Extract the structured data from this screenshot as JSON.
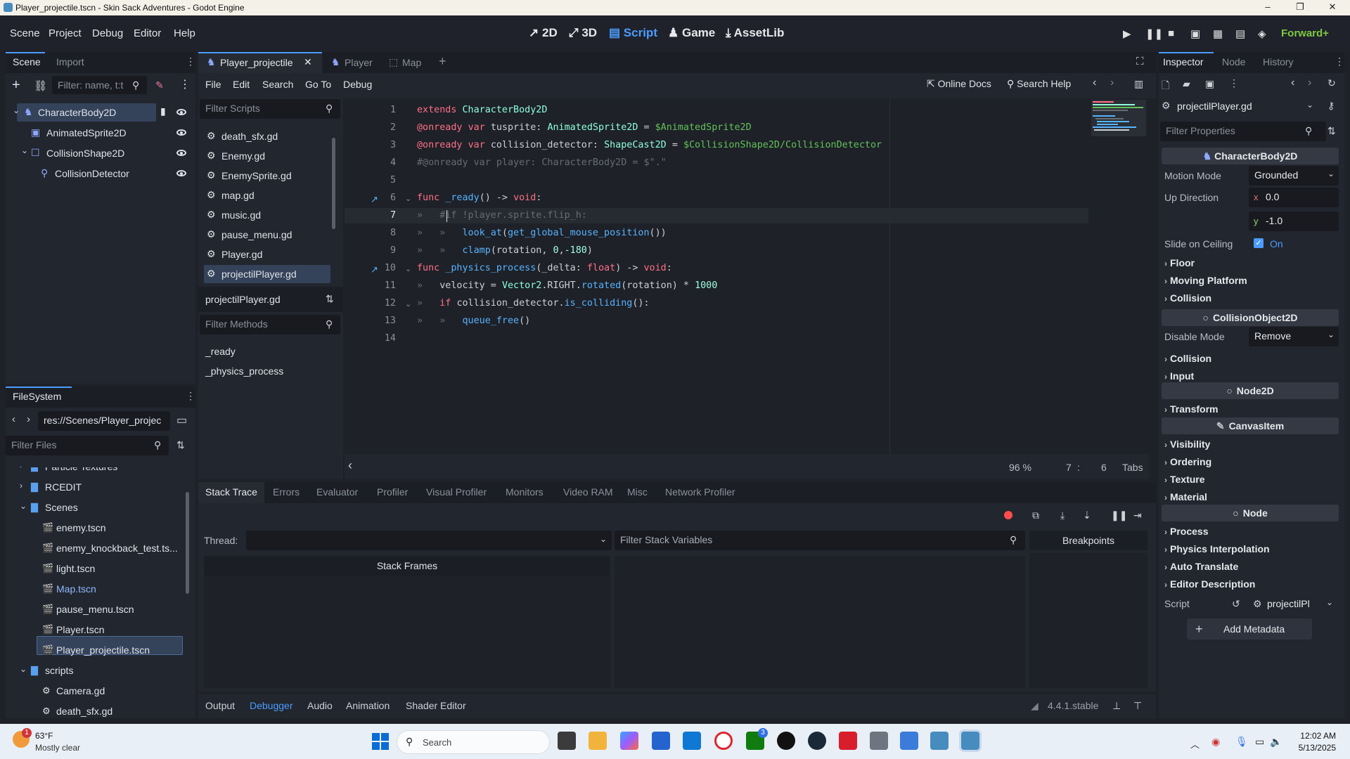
{
  "window": {
    "title": "Player_projectile.tscn - Skin Sack Adventures - Godot Engine",
    "minimize": "–",
    "maximize": "❐",
    "close": "✕"
  },
  "menu": [
    "Scene",
    "Project",
    "Debug",
    "Editor",
    "Help"
  ],
  "workspaces": [
    {
      "icon": "↗",
      "label": "2D"
    },
    {
      "icon": "⤢",
      "label": "3D"
    },
    {
      "icon": "▤",
      "label": "Script"
    },
    {
      "icon": "♟",
      "label": "Game"
    },
    {
      "icon": "⤓",
      "label": "AssetLib"
    }
  ],
  "renderer": "Forward+",
  "scene_dock": {
    "tabs": [
      "Scene",
      "Import"
    ],
    "filter_placeholder": "Filter: name, t:t",
    "nodes": [
      {
        "name": "CharacterBody2D",
        "icon": "character-body-icon",
        "selected": true
      },
      {
        "name": "AnimatedSprite2D",
        "icon": "animated-sprite-icon"
      },
      {
        "name": "CollisionShape2D",
        "icon": "collision-shape-icon"
      },
      {
        "name": "CollisionDetector",
        "icon": "shapecast-icon"
      }
    ]
  },
  "filesystem": {
    "tab": "FileSystem",
    "path": "res://Scenes/Player_projec",
    "filter_placeholder": "Filter Files",
    "items": [
      {
        "name": "Particle Textures",
        "type": "folder",
        "indent": 1
      },
      {
        "name": "RCEDIT",
        "type": "folder",
        "indent": 1
      },
      {
        "name": "Scenes",
        "type": "folder",
        "indent": 0,
        "open": true
      },
      {
        "name": "enemy.tscn",
        "type": "scene",
        "indent": 2
      },
      {
        "name": "enemy_knockback_test.ts...",
        "type": "scene",
        "indent": 2
      },
      {
        "name": "light.tscn",
        "type": "scene",
        "indent": 2
      },
      {
        "name": "Map.tscn",
        "type": "scene",
        "indent": 2,
        "link": true
      },
      {
        "name": "pause_menu.tscn",
        "type": "scene",
        "indent": 2
      },
      {
        "name": "Player.tscn",
        "type": "scene",
        "indent": 2
      },
      {
        "name": "Player_projectile.tscn",
        "type": "scene",
        "indent": 2,
        "selected": true
      },
      {
        "name": "scripts",
        "type": "folder",
        "indent": 0,
        "open": true
      },
      {
        "name": "Camera.gd",
        "type": "script",
        "indent": 2
      },
      {
        "name": "death_sfx.gd",
        "type": "script",
        "indent": 2
      }
    ]
  },
  "scene_tabs": [
    {
      "label": "Player_projectile",
      "active": true
    },
    {
      "label": "Player"
    },
    {
      "label": "Map"
    }
  ],
  "script_menu": [
    "File",
    "Edit",
    "Search",
    "Go To",
    "Debug"
  ],
  "script_toolbar": {
    "online_docs": "Online Docs",
    "search_help": "Search Help"
  },
  "script_list": {
    "filter_placeholder": "Filter Scripts",
    "items": [
      "death_sfx.gd",
      "Enemy.gd",
      "EnemySprite.gd",
      "map.gd",
      "music.gd",
      "pause_menu.gd",
      "Player.gd",
      "projectilPlayer.gd"
    ],
    "selected": "projectilPlayer.gd",
    "current": "projectilPlayer.gd",
    "methods_placeholder": "Filter Methods",
    "methods": [
      "_ready",
      "_physics_process"
    ]
  },
  "editor": {
    "lines": [
      "1",
      "2",
      "3",
      "4",
      "5",
      "6",
      "7",
      "8",
      "9",
      "10",
      "11",
      "12",
      "13",
      "14"
    ],
    "zoom": "96 %",
    "line": "7",
    "col": "6",
    "indent": "Tabs"
  },
  "bottom": {
    "tabs": [
      "Stack Trace",
      "Errors",
      "Evaluator",
      "Profiler",
      "Visual Profiler",
      "Monitors",
      "Video RAM",
      "Misc",
      "Network Profiler"
    ],
    "thread_label": "Thread:",
    "filter_vars": "Filter Stack Variables",
    "breakpoints": "Breakpoints",
    "stack_frames": "Stack Frames",
    "bar": [
      "Output",
      "Debugger",
      "Audio",
      "Animation",
      "Shader Editor"
    ],
    "active_bar": "Debugger",
    "version": "4.4.1.stable"
  },
  "inspector": {
    "tabs": [
      "Inspector",
      "Node",
      "History"
    ],
    "resource": "projectilPlayer.gd",
    "filter_placeholder": "Filter Properties",
    "class": "CharacterBody2D",
    "motion_mode_label": "Motion Mode",
    "motion_mode": "Grounded",
    "up_label": "Up Direction",
    "up_x_label": "x",
    "up_x": "0.0",
    "up_y_label": "y",
    "up_y": "-1.0",
    "slide_label": "Slide on Ceiling",
    "slide_value": "On",
    "groups1": [
      "Floor",
      "Moving Platform",
      "Collision"
    ],
    "class2": "CollisionObject2D",
    "disable_label": "Disable Mode",
    "disable_value": "Remove",
    "groups2": [
      "Collision",
      "Input"
    ],
    "class3": "Node2D",
    "groups3": [
      "Transform"
    ],
    "class4": "CanvasItem",
    "groups4": [
      "Visibility",
      "Ordering",
      "Texture",
      "Material"
    ],
    "class5": "Node",
    "groups5": [
      "Process",
      "Physics Interpolation",
      "Auto Translate",
      "Editor Description"
    ],
    "script_label": "Script",
    "script_value": "projectilPl",
    "add_metadata": "Add Metadata"
  },
  "taskbar": {
    "temp": "63°F",
    "weather": "Mostly clear",
    "badge": "1",
    "search": "Search",
    "time": "12:02 AM",
    "date": "5/13/2025",
    "xbox_badge": "3"
  },
  "colors": {
    "accent": "#4b9cff",
    "bg": "#22262e",
    "keyword": "#ff7085",
    "type": "#8effda",
    "string": "#ffeda1"
  }
}
